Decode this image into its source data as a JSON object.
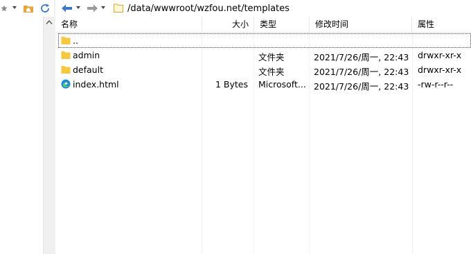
{
  "toolbar": {
    "left_icons": [
      "star-icon",
      "home-folder-icon",
      "refresh-icon"
    ],
    "nav_icons": [
      "back-arrow-icon",
      "forward-arrow-icon"
    ],
    "path": "/data/wwwroot/wzfou.net/templates"
  },
  "list": {
    "columns": {
      "name": "名称",
      "size": "大小",
      "type": "类型",
      "modified": "修改时间",
      "attributes": "属性"
    },
    "rows": [
      {
        "name": "..",
        "size": "",
        "type": "",
        "modified": "",
        "attributes": "",
        "icon": "folder-icon"
      },
      {
        "name": "admin",
        "size": "",
        "type": "文件夹",
        "modified": "2021/7/26/周一, 22:43",
        "attributes": "drwxr-xr-x",
        "icon": "folder-icon"
      },
      {
        "name": "default",
        "size": "",
        "type": "文件夹",
        "modified": "2021/7/26/周一, 22:43",
        "attributes": "drwxr-xr-x",
        "icon": "folder-icon"
      },
      {
        "name": "index.html",
        "size": "1 Bytes",
        "type": "Microsoft...",
        "modified": "2021/7/26/周一, 22:43",
        "attributes": "-rw-r--r--",
        "icon": "edge-browser-icon"
      }
    ]
  },
  "colors": {
    "folder": "#f5c842",
    "accent_blue": "#3a78c8",
    "header_border": "#e5e5e5"
  }
}
